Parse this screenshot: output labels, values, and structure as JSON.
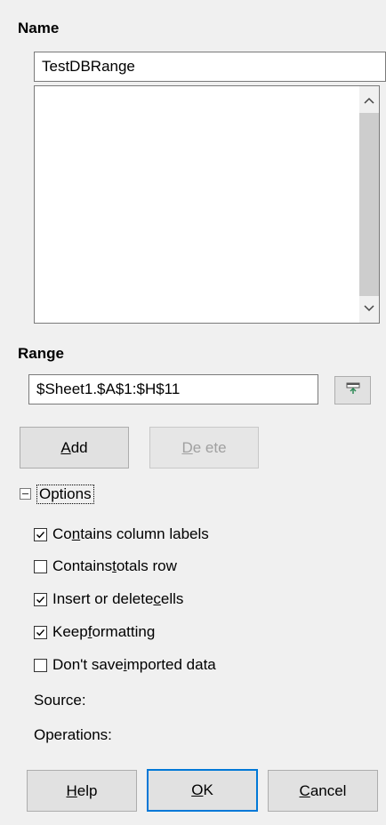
{
  "name_section": {
    "heading": "Name",
    "value": "TestDBRange",
    "list_items": []
  },
  "range_section": {
    "heading": "Range",
    "value": "$Sheet1.$A$1:$H$11",
    "shrink_icon": "shrink-range-icon"
  },
  "buttons": {
    "add": {
      "mnemonic": "A",
      "rest": "dd"
    },
    "delete": {
      "mnemonic": "D",
      "rest": "e ete"
    },
    "help": {
      "mnemonic": "H",
      "rest": "elp"
    },
    "ok": {
      "mnemonic": "O",
      "rest": "K"
    },
    "cancel": {
      "mnemonic": "C",
      "rest": "ancel"
    }
  },
  "options": {
    "label": "Options",
    "expanded": true,
    "items": [
      {
        "pre": "Co",
        "mnemonic": "n",
        "post": "tains column labels",
        "checked": true
      },
      {
        "pre": "Contains ",
        "mnemonic": "t",
        "post": "otals row",
        "checked": false
      },
      {
        "pre": "Insert or delete ",
        "mnemonic": "c",
        "post": "ells",
        "checked": true
      },
      {
        "pre": "Keep ",
        "mnemonic": "f",
        "post": "ormatting",
        "checked": true
      },
      {
        "pre": "Don't save ",
        "mnemonic": "i",
        "post": "mported data",
        "checked": false
      }
    ],
    "source_label": "Source:",
    "operations_label": "Operations:"
  },
  "colors": {
    "background": "#f0f0f0",
    "focus_border": "#0078d7",
    "disabled_text": "#a0a0a0"
  }
}
